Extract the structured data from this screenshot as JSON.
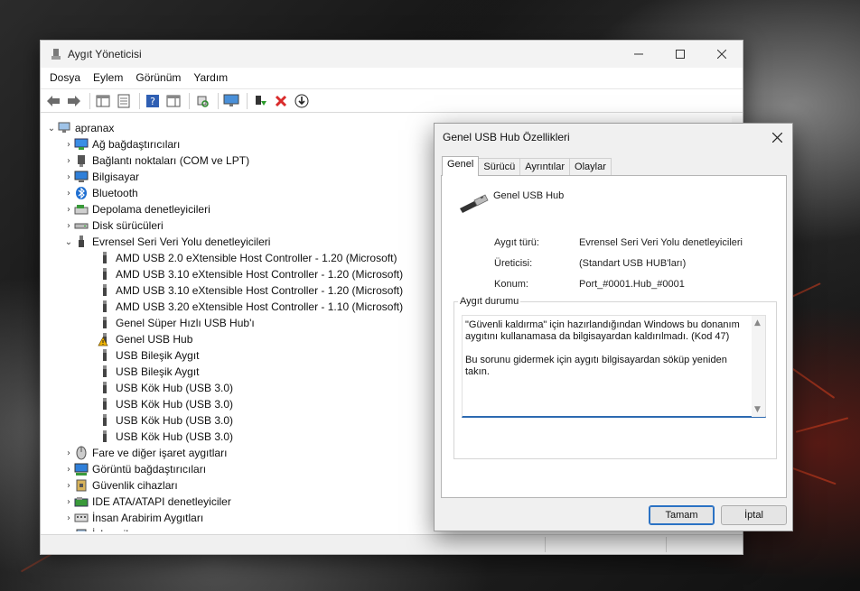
{
  "main_window": {
    "title": "Aygıt Yöneticisi",
    "menu": [
      "Dosya",
      "Eylem",
      "Görünüm",
      "Yardım"
    ]
  },
  "tree": {
    "root": "apranax",
    "categories_before": [
      {
        "label": "Ağ bağdaştırıcıları",
        "icon": "network-adapter-icon"
      },
      {
        "label": "Bağlantı noktaları (COM ve LPT)",
        "icon": "port-icon"
      },
      {
        "label": "Bilgisayar",
        "icon": "computer-icon"
      },
      {
        "label": "Bluetooth",
        "icon": "bluetooth-icon"
      },
      {
        "label": "Depolama denetleyicileri",
        "icon": "storage-controller-icon"
      },
      {
        "label": "Disk sürücüleri",
        "icon": "disk-drive-icon"
      }
    ],
    "usb_category": "Evrensel Seri Veri Yolu denetleyicileri",
    "usb_children": [
      {
        "label": "AMD USB 2.0 eXtensible Host Controller - 1.20 (Microsoft)",
        "warning": false
      },
      {
        "label": "AMD USB 3.10 eXtensible Host Controller - 1.20 (Microsoft)",
        "warning": false
      },
      {
        "label": "AMD USB 3.10 eXtensible Host Controller - 1.20 (Microsoft)",
        "warning": false
      },
      {
        "label": "AMD USB 3.20 eXtensible Host Controller - 1.10 (Microsoft)",
        "warning": false
      },
      {
        "label": "Genel Süper Hızlı USB Hub'ı",
        "warning": false
      },
      {
        "label": "Genel USB Hub",
        "warning": true
      },
      {
        "label": "USB Bileşik Aygıt",
        "warning": false
      },
      {
        "label": "USB Bileşik Aygıt",
        "warning": false
      },
      {
        "label": "USB Kök Hub (USB 3.0)",
        "warning": false
      },
      {
        "label": "USB Kök Hub (USB 3.0)",
        "warning": false
      },
      {
        "label": "USB Kök Hub (USB 3.0)",
        "warning": false
      },
      {
        "label": "USB Kök Hub (USB 3.0)",
        "warning": false
      }
    ],
    "categories_after": [
      {
        "label": "Fare ve diğer işaret aygıtları",
        "icon": "mouse-icon"
      },
      {
        "label": "Görüntü bağdaştırıcıları",
        "icon": "display-adapter-icon"
      },
      {
        "label": "Güvenlik cihazları",
        "icon": "security-device-icon"
      },
      {
        "label": "IDE ATA/ATAPI denetleyiciler",
        "icon": "ide-controller-icon"
      },
      {
        "label": "İnsan Arabirim Aygıtları",
        "icon": "hid-icon"
      },
      {
        "label": "İşlemciler",
        "icon": "processor-icon"
      }
    ]
  },
  "dialog": {
    "title": "Genel USB Hub Özellikleri",
    "tabs": [
      "Genel",
      "Sürücü",
      "Ayrıntılar",
      "Olaylar"
    ],
    "device_name": "Genel USB Hub",
    "properties": [
      {
        "label": "Aygıt türü:",
        "value": "Evrensel Seri Veri Yolu denetleyicileri"
      },
      {
        "label": "Üreticisi:",
        "value": "(Standart USB HUB'ları)"
      },
      {
        "label": "Konum:",
        "value": "Port_#0001.Hub_#0001"
      }
    ],
    "status_group_label": "Aygıt durumu",
    "status_line1": "\"Güvenli kaldırma\" için hazırlandığından Windows bu donanım aygıtını kullanamasa da bilgisayardan kaldırılmadı. (Kod 47)",
    "status_line2": "Bu sorunu gidermek için aygıtı bilgisayardan söküp yeniden takın.",
    "ok_label": "Tamam",
    "cancel_label": "İptal"
  },
  "colors": {
    "accent": "#2b72c4",
    "warning": "#f2b705",
    "error": "#d92b2b"
  }
}
